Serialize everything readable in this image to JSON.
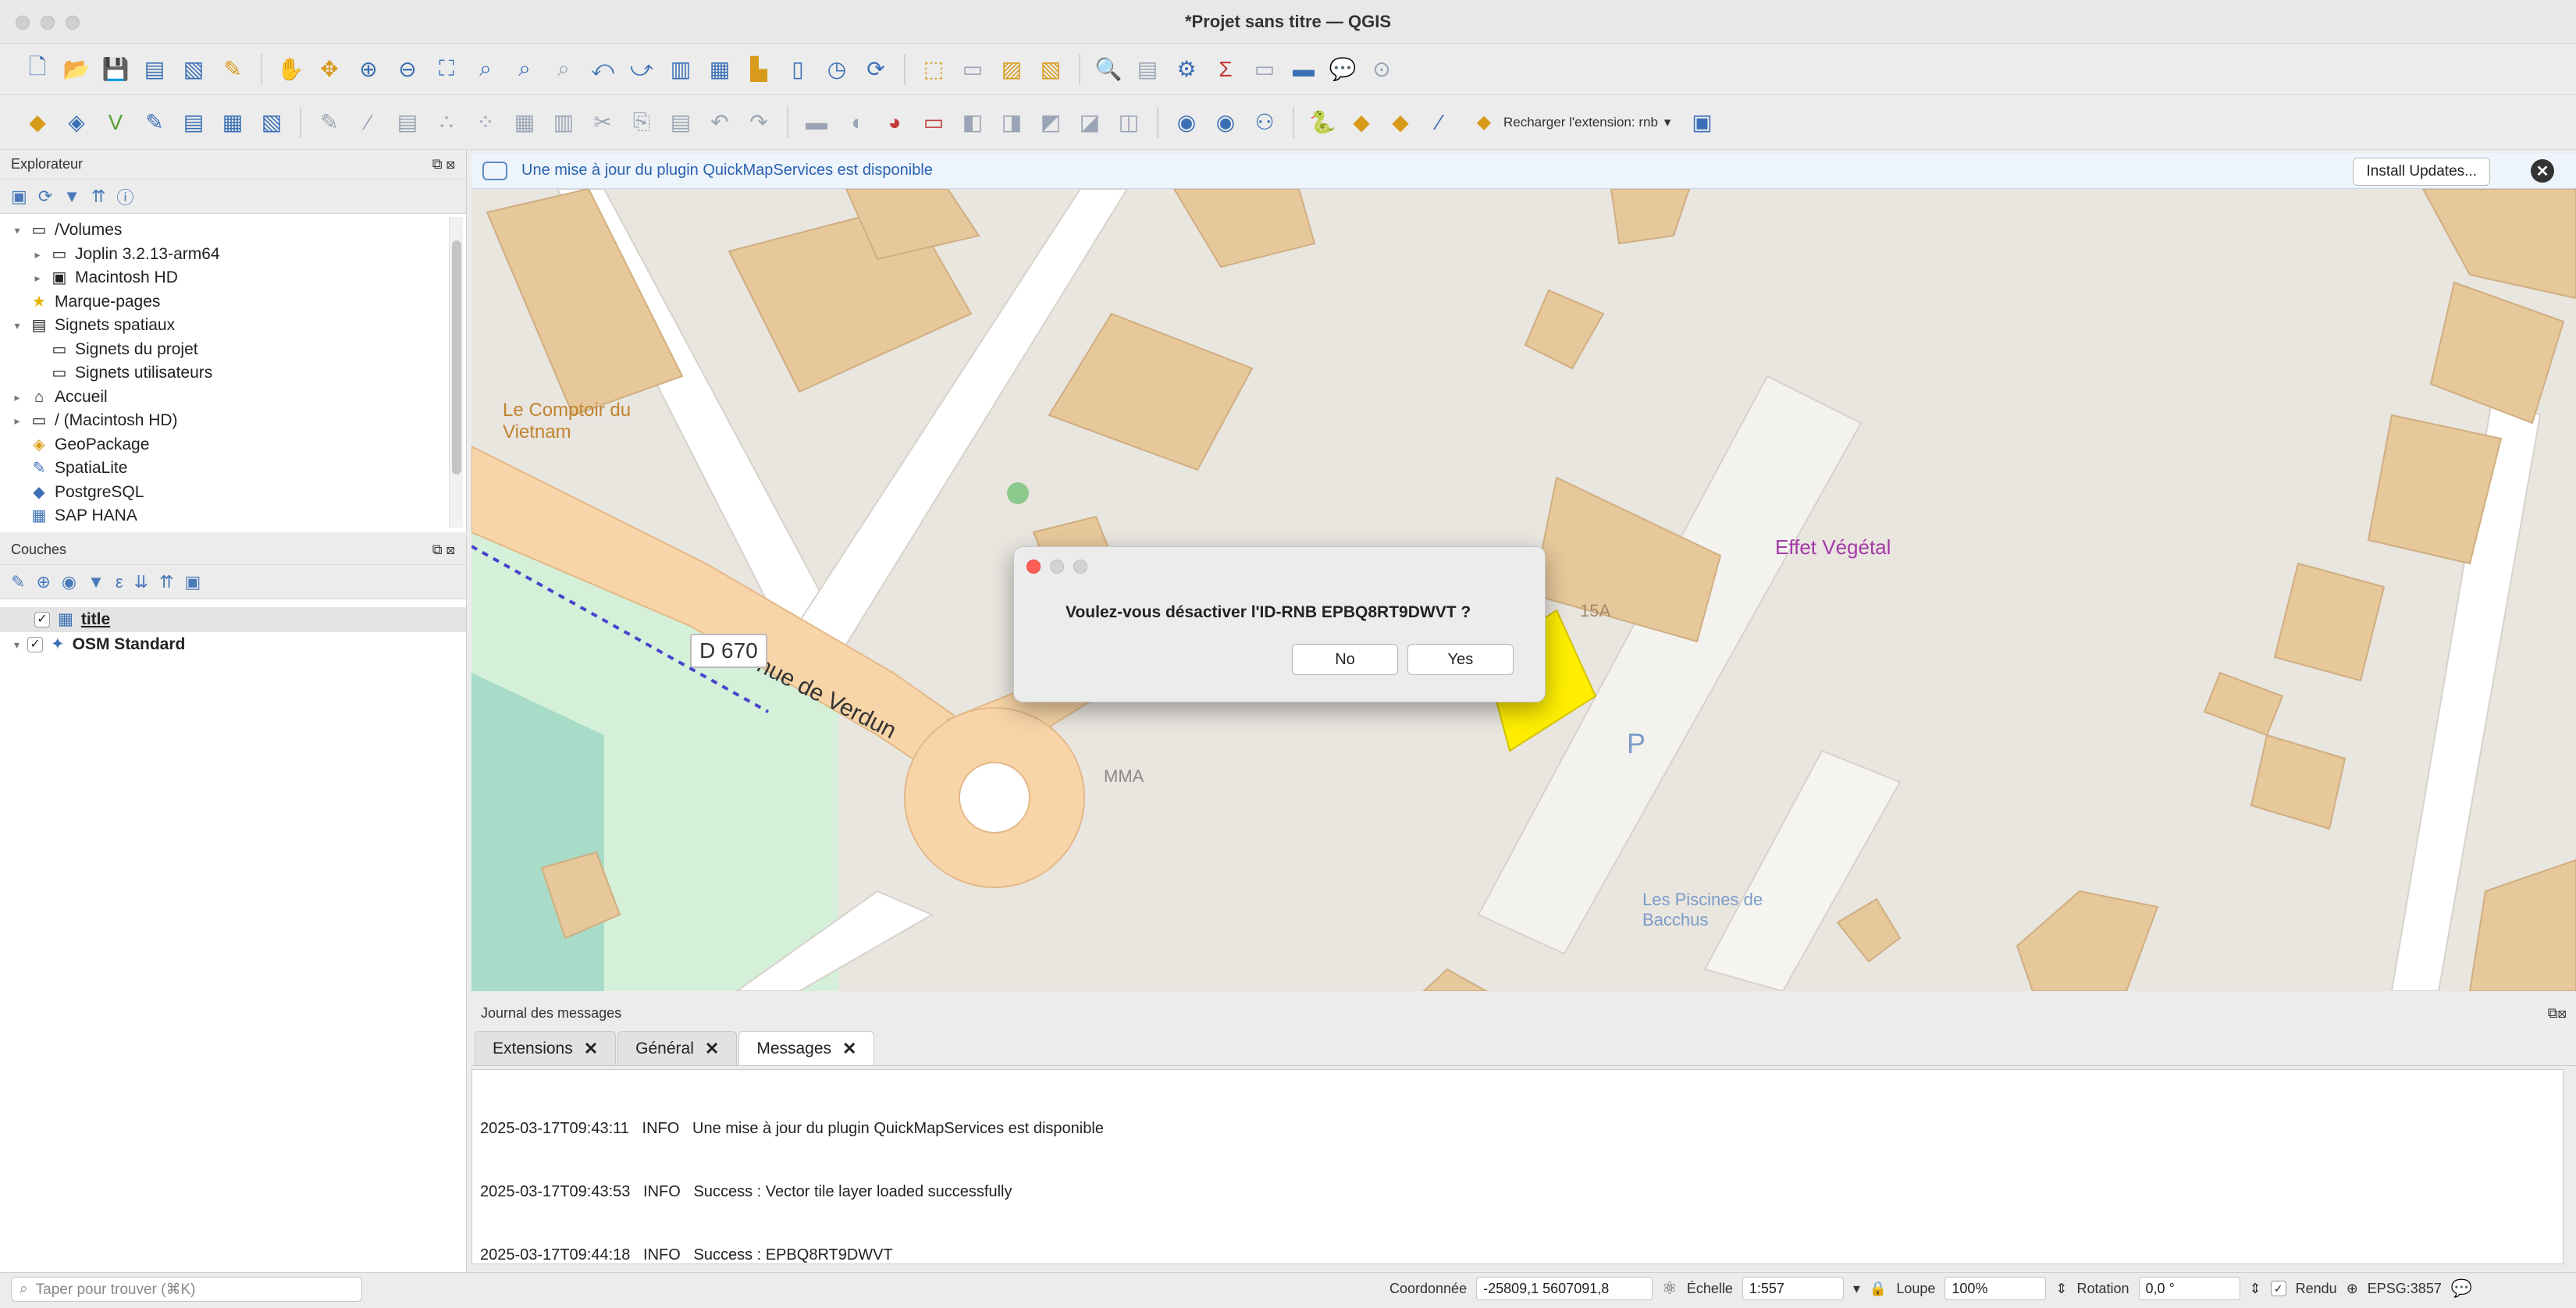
{
  "window": {
    "title": "*Projet sans titre — QGIS"
  },
  "toolbar": {
    "reload_label": "Recharger l'extension: rnb",
    "dropdown": "▾"
  },
  "browser": {
    "title": "Explorateur",
    "items": [
      {
        "label": "/Volumes",
        "arrow": "▾",
        "icon": "▭"
      },
      {
        "label": "Joplin 3.2.13-arm64",
        "arrow": "▸",
        "icon": "▭"
      },
      {
        "label": "Macintosh HD",
        "arrow": "▸",
        "icon": "▣"
      },
      {
        "label": "Marque-pages",
        "arrow": "",
        "icon": "★"
      },
      {
        "label": "Signets spatiaux",
        "arrow": "▾",
        "icon": "▤"
      },
      {
        "label": "Signets du projet",
        "arrow": "",
        "icon": "▭"
      },
      {
        "label": "Signets utilisateurs",
        "arrow": "",
        "icon": "▭"
      },
      {
        "label": "Accueil",
        "arrow": "▸",
        "icon": "⌂"
      },
      {
        "label": "/ (Macintosh HD)",
        "arrow": "▸",
        "icon": "▭"
      },
      {
        "label": "GeoPackage",
        "arrow": "",
        "icon": "◈"
      },
      {
        "label": "SpatiaLite",
        "arrow": "",
        "icon": "✎"
      },
      {
        "label": "PostgreSQL",
        "arrow": "",
        "icon": "◆"
      },
      {
        "label": "SAP HANA",
        "arrow": "",
        "icon": "▦"
      }
    ]
  },
  "layers": {
    "title": "Couches",
    "items": [
      {
        "label": "title",
        "checked": "✓",
        "icon": "▦"
      },
      {
        "label": "OSM Standard",
        "checked": "✓",
        "icon": "✦",
        "arrow": "▾"
      }
    ]
  },
  "message_bar": {
    "text": "Une mise à jour du plugin QuickMapServices est disponible",
    "install_button": "Install Updates...",
    "close": "✕"
  },
  "map": {
    "labels": {
      "road": "Avenue de Verdun",
      "route": "D 670",
      "poi_restaurant": "Le Comptoir du Vietnam",
      "poi_shop": "Effet Végétal",
      "poi_mma": "MMA",
      "poi_piscine": "Les Piscines de Bacchus",
      "parking": "P",
      "house_no": "15A"
    }
  },
  "dialog": {
    "message": "Voulez-vous désactiver l'ID-RNB EPBQ8RT9DWVT ?",
    "no": "No",
    "yes": "Yes"
  },
  "log": {
    "title": "Journal des messages",
    "tabs": [
      {
        "label": "Extensions",
        "close": "✕"
      },
      {
        "label": "Général",
        "close": "✕"
      },
      {
        "label": "Messages",
        "close": "✕"
      }
    ],
    "lines": [
      "2025-03-17T09:43:11   INFO   Une mise à jour du plugin QuickMapServices est disponible",
      "2025-03-17T09:43:53   INFO   Success : Vector tile layer loaded successfully",
      "2025-03-17T09:44:18   INFO   Success : EPBQ8RT9DWVT"
    ]
  },
  "status": {
    "search_placeholder": "Taper pour trouver (⌘K)",
    "coord_label": "Coordonnée",
    "coord_value": "-25809,1 5607091,8",
    "scale_label": "Échelle",
    "scale_value": "1:557",
    "loupe_label": "Loupe",
    "loupe_value": "100%",
    "rotation_label": "Rotation",
    "rotation_value": "0,0 °",
    "render_label": "Rendu",
    "crs": "EPSG:3857"
  }
}
